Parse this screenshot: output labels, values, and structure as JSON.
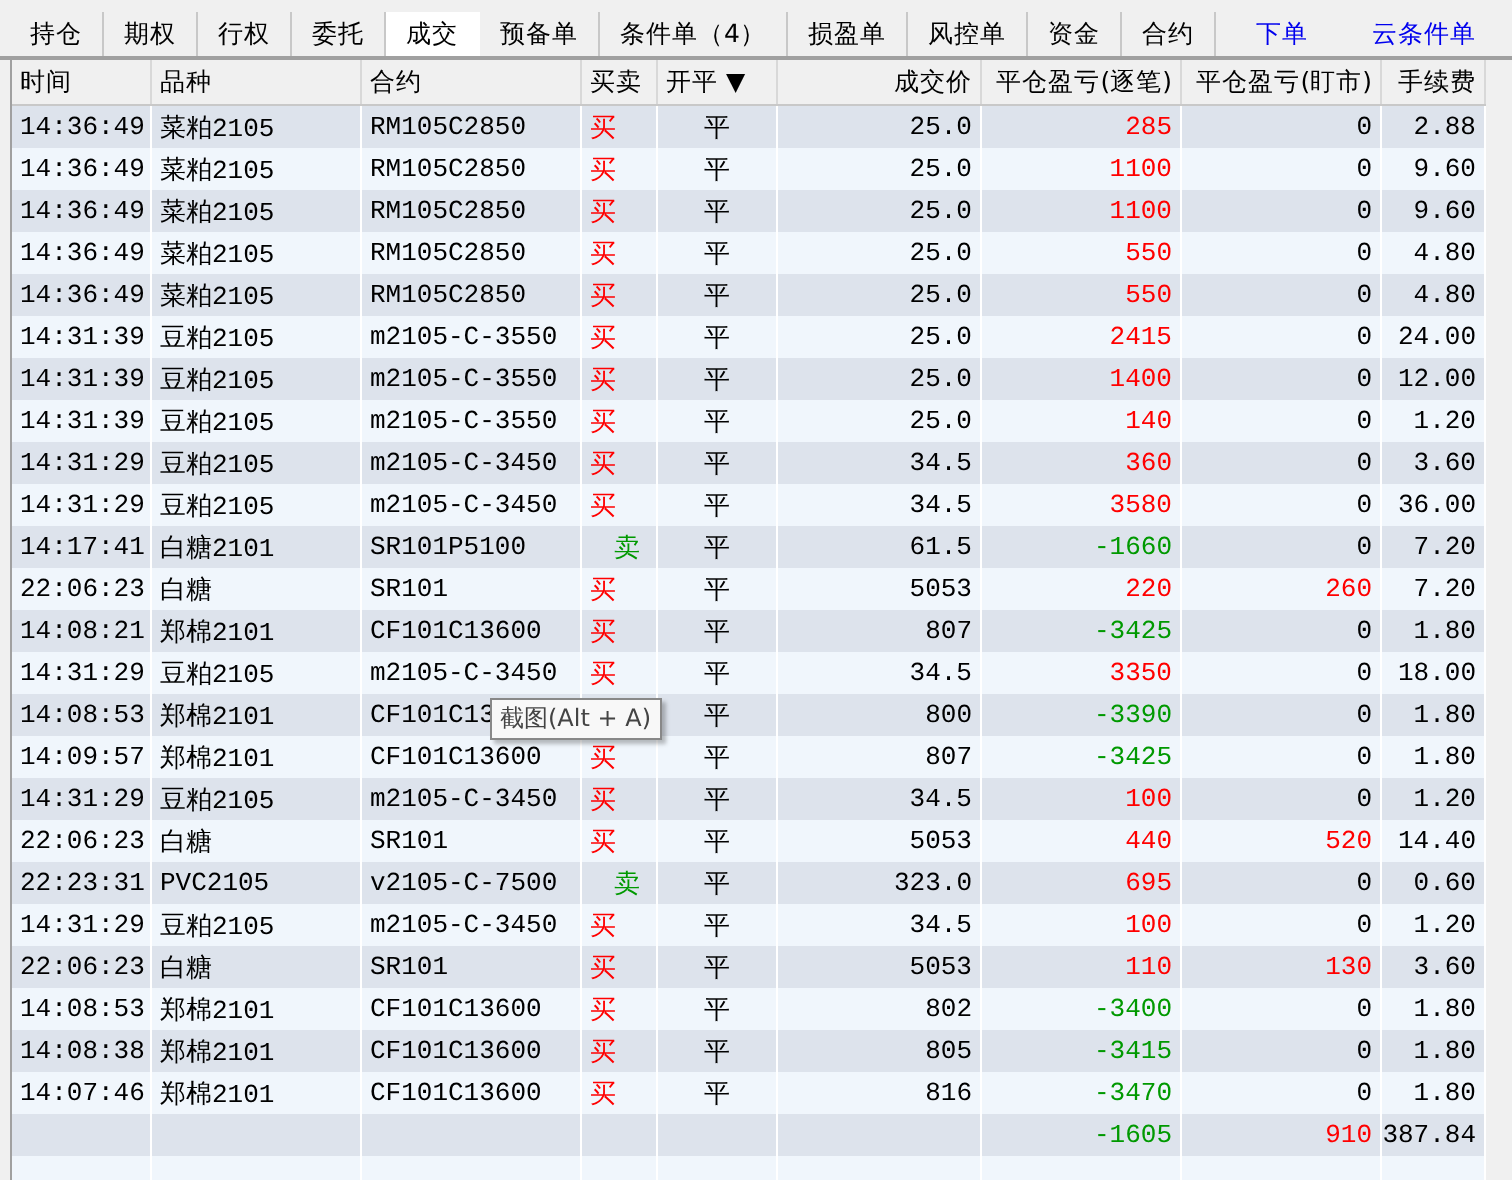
{
  "tabs": [
    {
      "label": "持仓",
      "selected": false
    },
    {
      "label": "期权",
      "selected": false
    },
    {
      "label": "行权",
      "selected": false
    },
    {
      "label": "委托",
      "selected": false
    },
    {
      "label": "成交",
      "selected": true
    },
    {
      "label": "预备单",
      "selected": false
    },
    {
      "label": "条件单（4）",
      "selected": false
    },
    {
      "label": "损盈单",
      "selected": false
    },
    {
      "label": "风控单",
      "selected": false
    },
    {
      "label": "资金",
      "selected": false
    },
    {
      "label": "合约",
      "selected": false
    }
  ],
  "links": [
    "下单",
    "云条件单"
  ],
  "table": {
    "columns": [
      {
        "label": "时间"
      },
      {
        "label": "品种"
      },
      {
        "label": "合约"
      },
      {
        "label": "买卖"
      },
      {
        "label": "开平",
        "sort_mark": "▼"
      },
      {
        "label": "成交价"
      },
      {
        "label": "平仓盈亏(逐笔)"
      },
      {
        "label": "平仓盈亏(盯市)"
      },
      {
        "label": "手续费"
      }
    ],
    "rows": [
      {
        "time": "14:36:49",
        "variety": "菜粕2105",
        "contract": "RM105C2850",
        "side": {
          "text": "买",
          "kind": "buy"
        },
        "open_close": "平",
        "price": "25.0",
        "pnl_trade": {
          "text": "285",
          "color": "#ff0000"
        },
        "pnl_mark": {
          "text": "0",
          "color": "#000000"
        },
        "fee": "2.88"
      },
      {
        "time": "14:36:49",
        "variety": "菜粕2105",
        "contract": "RM105C2850",
        "side": {
          "text": "买",
          "kind": "buy"
        },
        "open_close": "平",
        "price": "25.0",
        "pnl_trade": {
          "text": "1100",
          "color": "#ff0000"
        },
        "pnl_mark": {
          "text": "0",
          "color": "#000000"
        },
        "fee": "9.60"
      },
      {
        "time": "14:36:49",
        "variety": "菜粕2105",
        "contract": "RM105C2850",
        "side": {
          "text": "买",
          "kind": "buy"
        },
        "open_close": "平",
        "price": "25.0",
        "pnl_trade": {
          "text": "1100",
          "color": "#ff0000"
        },
        "pnl_mark": {
          "text": "0",
          "color": "#000000"
        },
        "fee": "9.60"
      },
      {
        "time": "14:36:49",
        "variety": "菜粕2105",
        "contract": "RM105C2850",
        "side": {
          "text": "买",
          "kind": "buy"
        },
        "open_close": "平",
        "price": "25.0",
        "pnl_trade": {
          "text": "550",
          "color": "#ff0000"
        },
        "pnl_mark": {
          "text": "0",
          "color": "#000000"
        },
        "fee": "4.80"
      },
      {
        "time": "14:36:49",
        "variety": "菜粕2105",
        "contract": "RM105C2850",
        "side": {
          "text": "买",
          "kind": "buy"
        },
        "open_close": "平",
        "price": "25.0",
        "pnl_trade": {
          "text": "550",
          "color": "#ff0000"
        },
        "pnl_mark": {
          "text": "0",
          "color": "#000000"
        },
        "fee": "4.80"
      },
      {
        "time": "14:31:39",
        "variety": "豆粕2105",
        "contract": "m2105-C-3550",
        "side": {
          "text": "买",
          "kind": "buy"
        },
        "open_close": "平",
        "price": "25.0",
        "pnl_trade": {
          "text": "2415",
          "color": "#ff0000"
        },
        "pnl_mark": {
          "text": "0",
          "color": "#000000"
        },
        "fee": "24.00"
      },
      {
        "time": "14:31:39",
        "variety": "豆粕2105",
        "contract": "m2105-C-3550",
        "side": {
          "text": "买",
          "kind": "buy"
        },
        "open_close": "平",
        "price": "25.0",
        "pnl_trade": {
          "text": "1400",
          "color": "#ff0000"
        },
        "pnl_mark": {
          "text": "0",
          "color": "#000000"
        },
        "fee": "12.00"
      },
      {
        "time": "14:31:39",
        "variety": "豆粕2105",
        "contract": "m2105-C-3550",
        "side": {
          "text": "买",
          "kind": "buy"
        },
        "open_close": "平",
        "price": "25.0",
        "pnl_trade": {
          "text": "140",
          "color": "#ff0000"
        },
        "pnl_mark": {
          "text": "0",
          "color": "#000000"
        },
        "fee": "1.20"
      },
      {
        "time": "14:31:29",
        "variety": "豆粕2105",
        "contract": "m2105-C-3450",
        "side": {
          "text": "买",
          "kind": "buy"
        },
        "open_close": "平",
        "price": "34.5",
        "pnl_trade": {
          "text": "360",
          "color": "#ff0000"
        },
        "pnl_mark": {
          "text": "0",
          "color": "#000000"
        },
        "fee": "3.60"
      },
      {
        "time": "14:31:29",
        "variety": "豆粕2105",
        "contract": "m2105-C-3450",
        "side": {
          "text": "买",
          "kind": "buy"
        },
        "open_close": "平",
        "price": "34.5",
        "pnl_trade": {
          "text": "3580",
          "color": "#ff0000"
        },
        "pnl_mark": {
          "text": "0",
          "color": "#000000"
        },
        "fee": "36.00"
      },
      {
        "time": "14:17:41",
        "variety": "白糖2101",
        "contract": "SR101P5100",
        "side": {
          "text": "卖",
          "kind": "sell"
        },
        "open_close": "平",
        "price": "61.5",
        "pnl_trade": {
          "text": "-1660",
          "color": "#009900"
        },
        "pnl_mark": {
          "text": "0",
          "color": "#000000"
        },
        "fee": "7.20"
      },
      {
        "time": "22:06:23",
        "variety": "白糖",
        "contract": "SR101",
        "side": {
          "text": "买",
          "kind": "buy"
        },
        "open_close": "平",
        "price": "5053",
        "pnl_trade": {
          "text": "220",
          "color": "#ff0000"
        },
        "pnl_mark": {
          "text": "260",
          "color": "#ff0000"
        },
        "fee": "7.20"
      },
      {
        "time": "14:08:21",
        "variety": "郑棉2101",
        "contract": "CF101C13600",
        "side": {
          "text": "买",
          "kind": "buy"
        },
        "open_close": "平",
        "price": "807",
        "pnl_trade": {
          "text": "-3425",
          "color": "#009900"
        },
        "pnl_mark": {
          "text": "0",
          "color": "#000000"
        },
        "fee": "1.80"
      },
      {
        "time": "14:31:29",
        "variety": "豆粕2105",
        "contract": "m2105-C-3450",
        "side": {
          "text": "买",
          "kind": "buy"
        },
        "open_close": "平",
        "price": "34.5",
        "pnl_trade": {
          "text": "3350",
          "color": "#ff0000"
        },
        "pnl_mark": {
          "text": "0",
          "color": "#000000"
        },
        "fee": "18.00"
      },
      {
        "time": "14:08:53",
        "variety": "郑棉2101",
        "contract": "CF101C13",
        "tooltip": "截图(Alt + A)",
        "open_close": "平",
        "price": "800",
        "pnl_trade": {
          "text": "-3390",
          "color": "#009900"
        },
        "pnl_mark": {
          "text": "0",
          "color": "#000000"
        },
        "fee": "1.80"
      },
      {
        "time": "14:09:57",
        "variety": "郑棉2101",
        "contract": "CF101C13600",
        "side": {
          "text": "买",
          "kind": "buy"
        },
        "open_close": "平",
        "price": "807",
        "pnl_trade": {
          "text": "-3425",
          "color": "#009900"
        },
        "pnl_mark": {
          "text": "0",
          "color": "#000000"
        },
        "fee": "1.80"
      },
      {
        "time": "14:31:29",
        "variety": "豆粕2105",
        "contract": "m2105-C-3450",
        "side": {
          "text": "买",
          "kind": "buy"
        },
        "open_close": "平",
        "price": "34.5",
        "pnl_trade": {
          "text": "100",
          "color": "#ff0000"
        },
        "pnl_mark": {
          "text": "0",
          "color": "#000000"
        },
        "fee": "1.20"
      },
      {
        "time": "22:06:23",
        "variety": "白糖",
        "contract": "SR101",
        "side": {
          "text": "买",
          "kind": "buy"
        },
        "open_close": "平",
        "price": "5053",
        "pnl_trade": {
          "text": "440",
          "color": "#ff0000"
        },
        "pnl_mark": {
          "text": "520",
          "color": "#ff0000"
        },
        "fee": "14.40"
      },
      {
        "time": "22:23:31",
        "variety": "PVC2105",
        "contract": "v2105-C-7500",
        "side": {
          "text": "卖",
          "kind": "sell"
        },
        "open_close": "平",
        "price": "323.0",
        "pnl_trade": {
          "text": "695",
          "color": "#ff0000"
        },
        "pnl_mark": {
          "text": "0",
          "color": "#000000"
        },
        "fee": "0.60"
      },
      {
        "time": "14:31:29",
        "variety": "豆粕2105",
        "contract": "m2105-C-3450",
        "side": {
          "text": "买",
          "kind": "buy"
        },
        "open_close": "平",
        "price": "34.5",
        "pnl_trade": {
          "text": "100",
          "color": "#ff0000"
        },
        "pnl_mark": {
          "text": "0",
          "color": "#000000"
        },
        "fee": "1.20"
      },
      {
        "time": "22:06:23",
        "variety": "白糖",
        "contract": "SR101",
        "side": {
          "text": "买",
          "kind": "buy"
        },
        "open_close": "平",
        "price": "5053",
        "pnl_trade": {
          "text": "110",
          "color": "#ff0000"
        },
        "pnl_mark": {
          "text": "130",
          "color": "#ff0000"
        },
        "fee": "3.60"
      },
      {
        "time": "14:08:53",
        "variety": "郑棉2101",
        "contract": "CF101C13600",
        "side": {
          "text": "买",
          "kind": "buy"
        },
        "open_close": "平",
        "price": "802",
        "pnl_trade": {
          "text": "-3400",
          "color": "#009900"
        },
        "pnl_mark": {
          "text": "0",
          "color": "#000000"
        },
        "fee": "1.80"
      },
      {
        "time": "14:08:38",
        "variety": "郑棉2101",
        "contract": "CF101C13600",
        "side": {
          "text": "买",
          "kind": "buy"
        },
        "open_close": "平",
        "price": "805",
        "pnl_trade": {
          "text": "-3415",
          "color": "#009900"
        },
        "pnl_mark": {
          "text": "0",
          "color": "#000000"
        },
        "fee": "1.80"
      },
      {
        "time": "14:07:46",
        "variety": "郑棉2101",
        "contract": "CF101C13600",
        "side": {
          "text": "买",
          "kind": "buy"
        },
        "open_close": "平",
        "price": "816",
        "pnl_trade": {
          "text": "-3470",
          "color": "#009900"
        },
        "pnl_mark": {
          "text": "0",
          "color": "#000000"
        },
        "fee": "1.80"
      }
    ],
    "total": {
      "pnl_trade": {
        "text": "-1605",
        "color": "#009900"
      },
      "pnl_mark": {
        "text": "910",
        "color": "#ff0000"
      },
      "fee": "387.84"
    }
  }
}
